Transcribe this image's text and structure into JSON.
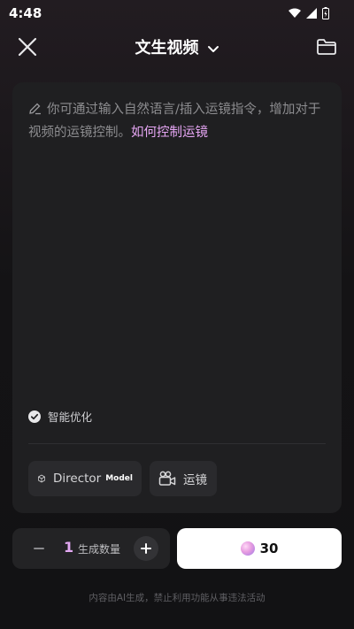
{
  "status_bar": {
    "time": "4:48"
  },
  "header": {
    "title": "文生视频"
  },
  "prompt": {
    "placeholder": "你可通过输入自然语言/插入运镜指令，增加对于视频的运镜控制。",
    "link": "如何控制运镜"
  },
  "options": {
    "smart_optimize": "智能优化",
    "smart_optimize_checked": true
  },
  "tools": {
    "director_label": "Director",
    "director_tag": "Model",
    "camera_label": "运镜"
  },
  "quantity": {
    "value": "1",
    "label": "生成数量"
  },
  "generate": {
    "cost": "30"
  },
  "footer": {
    "disclaimer": "内容由AI生成，禁止利用功能从事违法活动"
  },
  "colors": {
    "accent": "#e2a8f2",
    "card": "#1f1f21",
    "button": "#ffffff"
  }
}
